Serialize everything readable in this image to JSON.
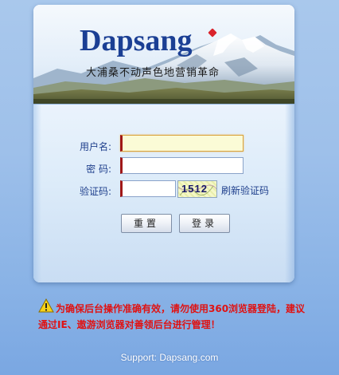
{
  "brand": {
    "logo_text": "Dapsang",
    "tagline": "大浦桑不动声色地营销革命"
  },
  "form": {
    "username_label": "用户名:",
    "username_value": "",
    "password_label": "密 码:",
    "password_value": "",
    "captcha_label": "验证码:",
    "captcha_value": "",
    "captcha_image_text": "1512",
    "refresh_captcha_link": "刷新验证码",
    "reset_button": "重置",
    "login_button": "登录"
  },
  "notice": {
    "icon": "warning-icon",
    "text": "为确保后台操作准确有效，请勿使用360浏览器登陆，建议通过IE、遨游浏览器对善领后台进行管理！"
  },
  "footer": {
    "support_text": "Support: Dapsang.com"
  },
  "colors": {
    "brand_blue": "#1b3f94",
    "warning_red": "#e01212",
    "background_blue": "#9ec0ea"
  }
}
